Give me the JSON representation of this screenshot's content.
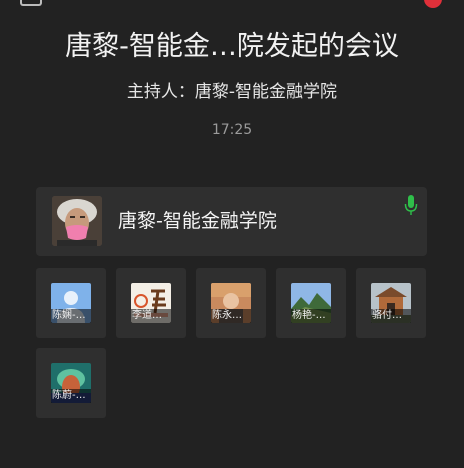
{
  "meeting": {
    "title": "唐黎-智能金…院发起的会议",
    "host": "主持人：唐黎-智能金融学院",
    "time": "17:25"
  },
  "speaker": {
    "name": "唐黎-智能金融学院",
    "mic_icon": "microphone-icon",
    "mic_color": "#2fbf4a"
  },
  "participants": [
    {
      "label": "陈娴-…"
    },
    {
      "label": "李道…"
    },
    {
      "label": "陈永…"
    },
    {
      "label": "杨艳-…"
    },
    {
      "label": "骆付…"
    },
    {
      "label": "陈蔚-…"
    }
  ]
}
